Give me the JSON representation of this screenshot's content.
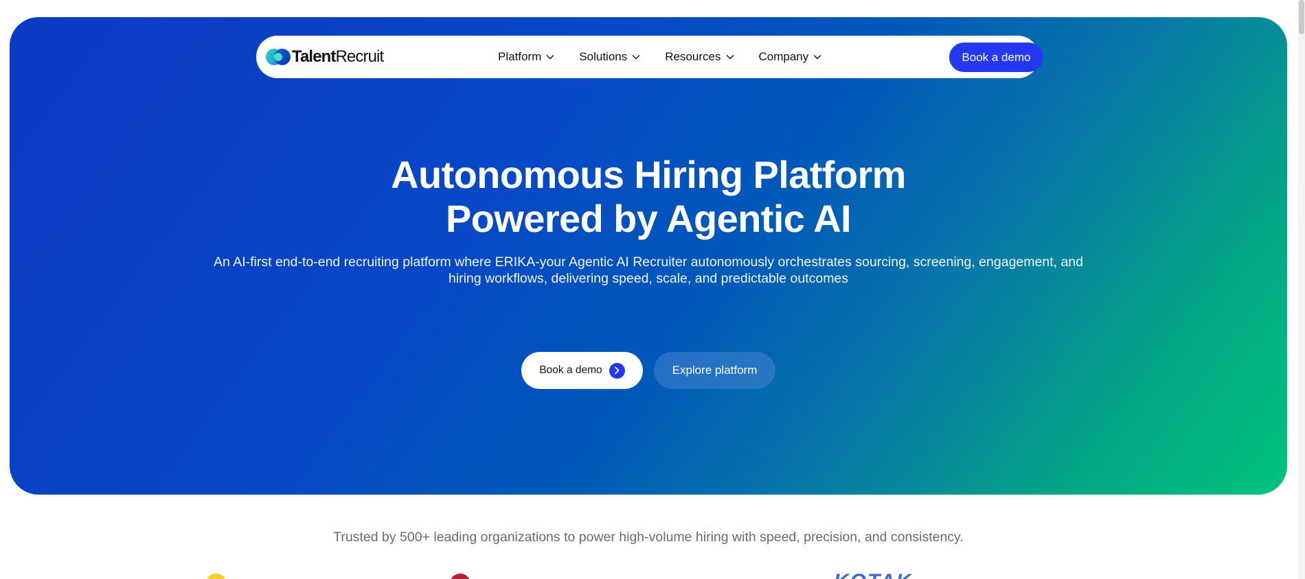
{
  "brand": {
    "name_bold": "Talent",
    "name_light": "Recruit",
    "logo_icon": "talentrecruit-logo-icon",
    "accent_color": "#2338f0"
  },
  "nav": {
    "items": [
      {
        "label": "Platform",
        "icon": "chevron-down-icon"
      },
      {
        "label": "Solutions",
        "icon": "chevron-down-icon"
      },
      {
        "label": "Resources",
        "icon": "chevron-down-icon"
      },
      {
        "label": "Company",
        "icon": "chevron-down-icon"
      }
    ],
    "cta_label": "Book a demo"
  },
  "hero": {
    "headline_line1": "Autonomous Hiring Platform",
    "headline_line2": "Powered by Agentic AI",
    "subheadline": "An AI-first end-to-end recruiting platform where ERIKA-your Agentic AI Recruiter autonomously orchestrates sourcing, screening, engagement, and hiring workflows, delivering speed, scale, and predictable outcomes",
    "primary_button": "Book a demo",
    "primary_button_icon": "chevron-right-icon",
    "secondary_button": "Explore platform",
    "gradient_start": "#0d3ac3",
    "gradient_end": "#00c47c"
  },
  "trusted": {
    "text": "Trusted by 500+ leading organizations to power high-volume hiring with speed, precision, and consistency."
  },
  "partner_logos": [
    {
      "name": "partner-logo-yellow"
    },
    {
      "name": "partner-logo-red"
    },
    {
      "name": "partner-logo-wordmark",
      "text": "KOTAK"
    }
  ]
}
